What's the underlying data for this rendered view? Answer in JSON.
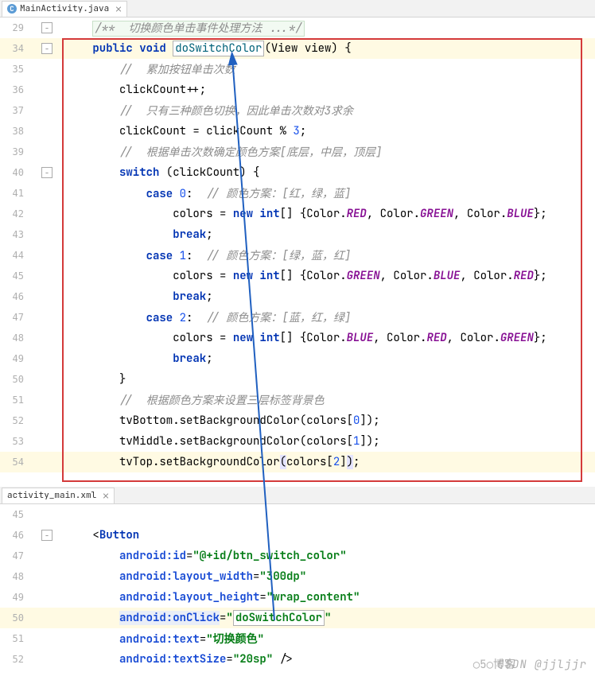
{
  "tabs": {
    "top": {
      "icon": "C",
      "name": "MainActivity.java"
    },
    "bottom": {
      "name": "activity_main.xml"
    }
  },
  "watermark1": "CSDN @jjljjr",
  "watermark2": "○5○博客",
  "lines_top": [
    {
      "n": "29",
      "f": "-",
      "html": "      <span class='jdoc'>/**  切换颜色单击事件处理方法 ...*/</span>"
    },
    {
      "n": "34",
      "f": "-",
      "caret": true,
      "html": "      <span class='kw'>public</span> <span class='kw'>void</span> <span class='box-method fn'>doSwitchColor</span>(View view) {"
    },
    {
      "n": "35",
      "html": "          <span class='cm'>//  累加按钮单击次数</span>"
    },
    {
      "n": "36",
      "html": "          clickCount++;"
    },
    {
      "n": "37",
      "html": "          <span class='cm'>//  只有三种颜色切换，因此单击次数对3求余</span>"
    },
    {
      "n": "38",
      "html": "          clickCount = clickCount % <span class='num'>3</span>;"
    },
    {
      "n": "39",
      "html": "          <span class='cm'>//  根据单击次数确定颜色方案[底层，中层，顶层]</span>"
    },
    {
      "n": "40",
      "f": "-",
      "html": "          <span class='kw'>switch</span> (clickCount) {"
    },
    {
      "n": "41",
      "html": "              <span class='kw'>case</span> <span class='num'>0</span>:  <span class='cm'>// 颜色方案：[红，绿，蓝]</span>"
    },
    {
      "n": "42",
      "html": "                  colors = <span class='kw'>new</span> <span class='kw'>int</span>[] {Color.<span class='pu'>RED</span>, Color.<span class='pu'>GREEN</span>, Color.<span class='pu'>BLUE</span>};"
    },
    {
      "n": "43",
      "html": "                  <span class='kw'>break</span>;"
    },
    {
      "n": "44",
      "html": "              <span class='kw'>case</span> <span class='num'>1</span>:  <span class='cm'>// 颜色方案：[绿，蓝，红]</span>"
    },
    {
      "n": "45",
      "html": "                  colors = <span class='kw'>new</span> <span class='kw'>int</span>[] {Color.<span class='pu'>GREEN</span>, Color.<span class='pu'>BLUE</span>, Color.<span class='pu'>RED</span>};"
    },
    {
      "n": "46",
      "html": "                  <span class='kw'>break</span>;"
    },
    {
      "n": "47",
      "html": "              <span class='kw'>case</span> <span class='num'>2</span>:  <span class='cm'>// 颜色方案：[蓝，红，绿]</span>"
    },
    {
      "n": "48",
      "html": "                  colors = <span class='kw'>new</span> <span class='kw'>int</span>[] {Color.<span class='pu'>BLUE</span>, Color.<span class='pu'>RED</span>, Color.<span class='pu'>GREEN</span>};"
    },
    {
      "n": "49",
      "html": "                  <span class='kw'>break</span>;"
    },
    {
      "n": "50",
      "html": "          }"
    },
    {
      "n": "51",
      "html": "          <span class='cm'>//  根据颜色方案来设置三层标签背景色</span>"
    },
    {
      "n": "52",
      "html": "          tvBottom.setBackgroundColor(colors[<span class='num'>0</span>]);"
    },
    {
      "n": "53",
      "html": "          tvMiddle.setBackgroundColor(colors[<span class='num'>1</span>]);"
    },
    {
      "n": "54",
      "caret": true,
      "html": "          tvTop.setBackgroundColor<span class='hl-match'>(</span>colors[<span class='num'>2</span>]<span class='hl-match'>)</span>;"
    },
    {
      "n": "",
      "html": "      "
    }
  ],
  "lines_bottom": [
    {
      "n": "45",
      "html": ""
    },
    {
      "n": "46",
      "f": "-",
      "html": "      &lt;<span class='xn'>Button</span>"
    },
    {
      "n": "47",
      "html": "          <span class='xa'>android:id</span>=<span class='xv'>\"@+id/btn_switch_color\"</span>"
    },
    {
      "n": "48",
      "html": "          <span class='xa'>android:layout_width</span>=<span class='xv'>\"300dp\"</span>"
    },
    {
      "n": "49",
      "html": "          <span class='xa'>android:layout_height</span>=<span class='xv'>\"wrap_content\"</span>"
    },
    {
      "n": "50",
      "caret": true,
      "html": "          <span class='hl-attr'><span class='xa'>android:onClick</span></span>=<span class='xv'>\"</span><span class='box-method xv'>doSwitchColor</span><span class='xv'>\"</span>"
    },
    {
      "n": "51",
      "html": "          <span class='xa'>android:text</span>=<span class='xv'>\"切换颜色\"</span>"
    },
    {
      "n": "52",
      "html": "          <span class='xa'>android:textSize</span>=<span class='xv'>\"20sp\"</span> /&gt;"
    }
  ]
}
